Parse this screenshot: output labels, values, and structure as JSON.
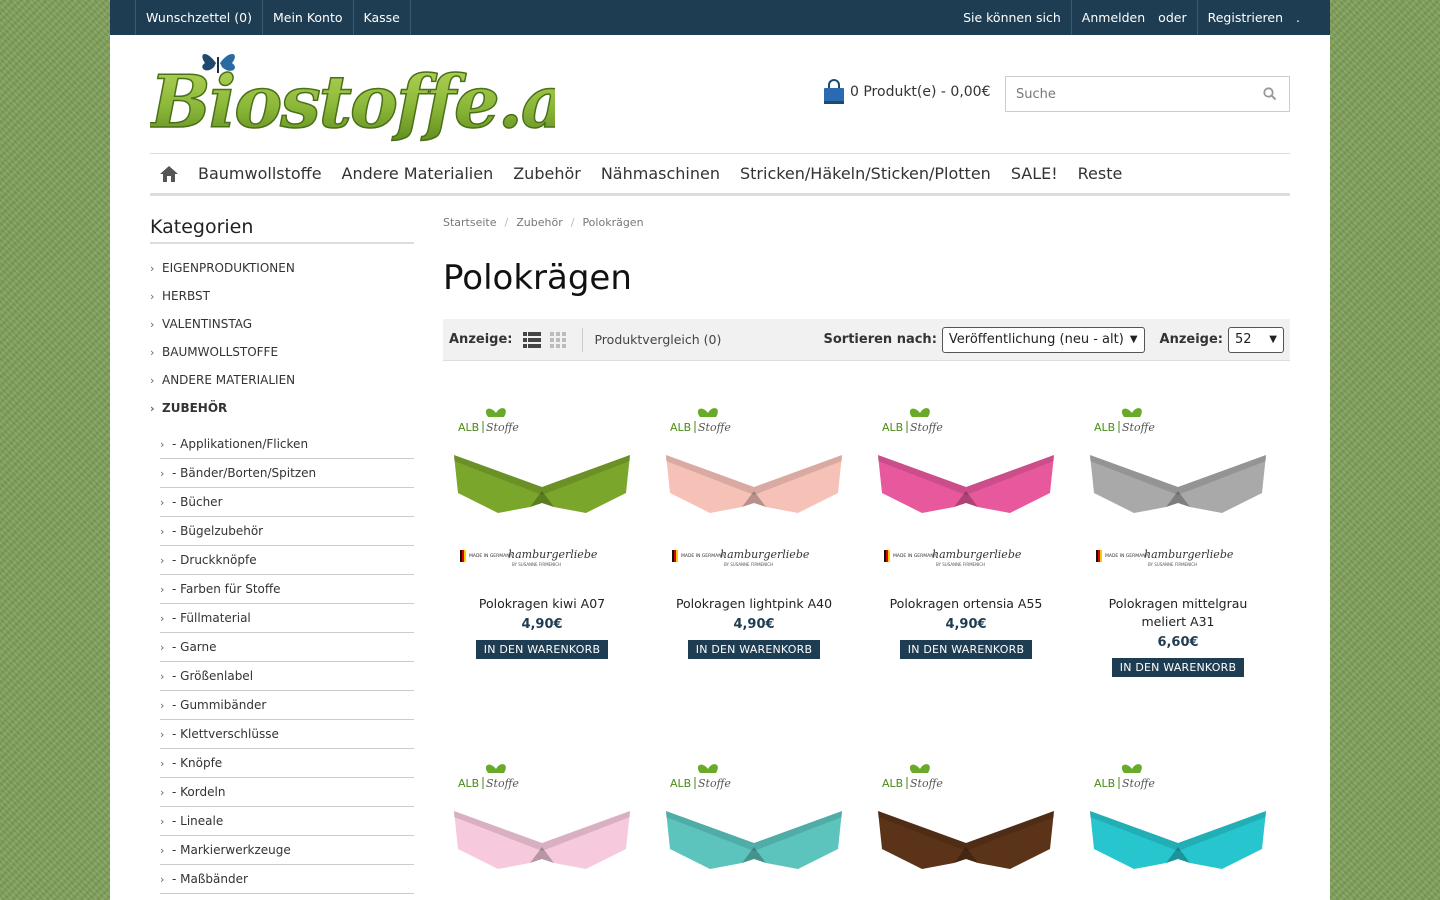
{
  "topbar": {
    "wishlist": "Wunschzettel (0)",
    "account": "Mein Konto",
    "checkout": "Kasse",
    "login_prefix": "Sie können sich",
    "login": "Anmelden",
    "or": "oder",
    "register": "Registrieren",
    "dot": "."
  },
  "header": {
    "logo_text": "Biostoffe.at",
    "cart_text": "0 Produkt(e) - 0,00€",
    "search_placeholder": "Suche"
  },
  "nav": [
    "Baumwollstoffe",
    "Andere Materialien",
    "Zubehör",
    "Nähmaschinen",
    "Stricken/Häkeln/Sticken/Plotten",
    "SALE!",
    "Reste"
  ],
  "sidebar": {
    "title": "Kategorien",
    "categories": [
      "EIGENPRODUKTIONEN",
      "HERBST",
      "VALENTINSTAG",
      "BAUMWOLLSTOFFE",
      "ANDERE MATERIALIEN",
      "ZUBEHÖR"
    ],
    "subcategories": [
      "- Applikationen/Flicken",
      "- Bänder/Borten/Spitzen",
      "- Bücher",
      "- Bügelzubehör",
      "- Druckknöpfe",
      "- Farben für Stoffe",
      "- Füllmaterial",
      "- Garne",
      "- Größenlabel",
      "- Gummibänder",
      "- Klettverschlüsse",
      "- Knöpfe",
      "- Kordeln",
      "- Lineale",
      "- Markierwerkzeuge",
      "- Maßbänder"
    ]
  },
  "breadcrumb": [
    "Startseite",
    "Zubehör",
    "Polokrägen"
  ],
  "page_title": "Polokrägen",
  "toolbar": {
    "view_label": "Anzeige:",
    "compare": "Produktvergleich (0)",
    "sort_label": "Sortieren nach:",
    "sort_value": "Veröffentlichung (neu - alt)",
    "limit_label": "Anzeige:",
    "limit_value": "52"
  },
  "products": [
    {
      "name": "Polokragen kiwi A07",
      "price": "4,90€",
      "button": "IN DEN WARENKORB",
      "color": "#7aa62c"
    },
    {
      "name": "Polokragen lightpink A40",
      "price": "4,90€",
      "button": "IN DEN WARENKORB",
      "color": "#f6c2b8"
    },
    {
      "name": "Polokragen ortensia A55",
      "price": "4,90€",
      "button": "IN DEN WARENKORB",
      "color": "#e8589c"
    },
    {
      "name": "Polokragen mittelgrau meliert A31",
      "price": "6,60€",
      "button": "IN DEN WARENKORB",
      "color": "#a9a9a9"
    },
    {
      "color": "#f7c9dc"
    },
    {
      "color": "#5cc4bd"
    },
    {
      "color": "#5b3319"
    },
    {
      "color": "#27c6cf"
    }
  ],
  "brand": {
    "label_left": "ALB",
    "label_right": "Stoffe",
    "made_in": "MADE IN GERMANY",
    "maker": "hamburgerliebe",
    "maker_sub": "BY SUSANNE FIRMENICH"
  },
  "colors": {
    "topbar": "#1e3d52",
    "accent": "#1e3d52",
    "logo_green": "#8cb83a"
  }
}
